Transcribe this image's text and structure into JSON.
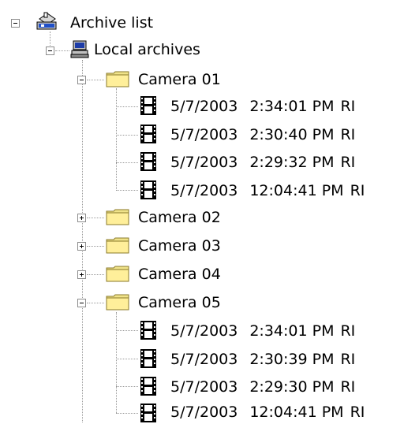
{
  "tree": {
    "root": {
      "label": "Archive list",
      "icon": "archive-list-icon",
      "expanded": true
    },
    "local": {
      "label": "Local archives",
      "icon": "computer-icon",
      "expanded": true
    },
    "cameras": [
      {
        "label": "Camera 01",
        "icon": "folder-icon",
        "expanded": true,
        "records": [
          {
            "date": "5/7/2003",
            "time": "2:34:01 PM",
            "flag": "RI"
          },
          {
            "date": "5/7/2003",
            "time": "2:30:40 PM",
            "flag": "RI"
          },
          {
            "date": "5/7/2003",
            "time": "2:29:32 PM",
            "flag": "RI"
          },
          {
            "date": "5/7/2003",
            "time": "12:04:41 PM",
            "flag": "RI"
          }
        ]
      },
      {
        "label": "Camera 02",
        "icon": "folder-icon",
        "expanded": false,
        "records": []
      },
      {
        "label": "Camera 03",
        "icon": "folder-icon",
        "expanded": false,
        "records": []
      },
      {
        "label": "Camera 04",
        "icon": "folder-icon",
        "expanded": false,
        "records": []
      },
      {
        "label": "Camera 05",
        "icon": "folder-icon",
        "expanded": true,
        "records": [
          {
            "date": "5/7/2003",
            "time": "2:34:01 PM",
            "flag": "RI"
          },
          {
            "date": "5/7/2003",
            "time": "2:30:39 PM",
            "flag": "RI"
          },
          {
            "date": "5/7/2003",
            "time": "2:29:30 PM",
            "flag": "RI"
          },
          {
            "date": "5/7/2003",
            "time": "12:04:41 PM",
            "flag": "RI"
          }
        ]
      }
    ]
  }
}
